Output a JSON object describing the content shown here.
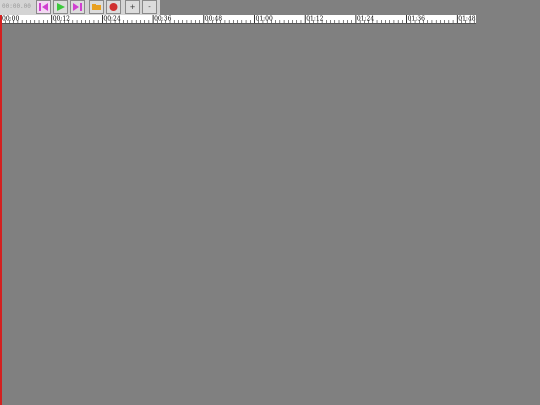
{
  "toolbar": {
    "timecode": "00:00.00",
    "buttons": {
      "rewind": "rewind-to-start-icon",
      "play": "play-icon",
      "forward": "skip-to-end-icon",
      "open": "open-folder-icon",
      "record": "record-icon",
      "zoom_in_label": "+",
      "zoom_out_label": "-"
    }
  },
  "ruler": {
    "labels": [
      "00:00",
      "00:12",
      "00:24",
      "00:36",
      "00:48",
      "01:00",
      "01:12",
      "01:24",
      "01:36",
      "01:48"
    ],
    "major_interval_seconds": 12,
    "minor_ticks_per_major": 12
  },
  "colors": {
    "timeline_bg": "#808080",
    "playhead": "#d42020",
    "play_green": "#3cc83c",
    "rewind_magenta": "#d040d0",
    "record_red": "#d03030",
    "folder_orange": "#e8a020"
  },
  "playhead": {
    "position_seconds": 0
  }
}
